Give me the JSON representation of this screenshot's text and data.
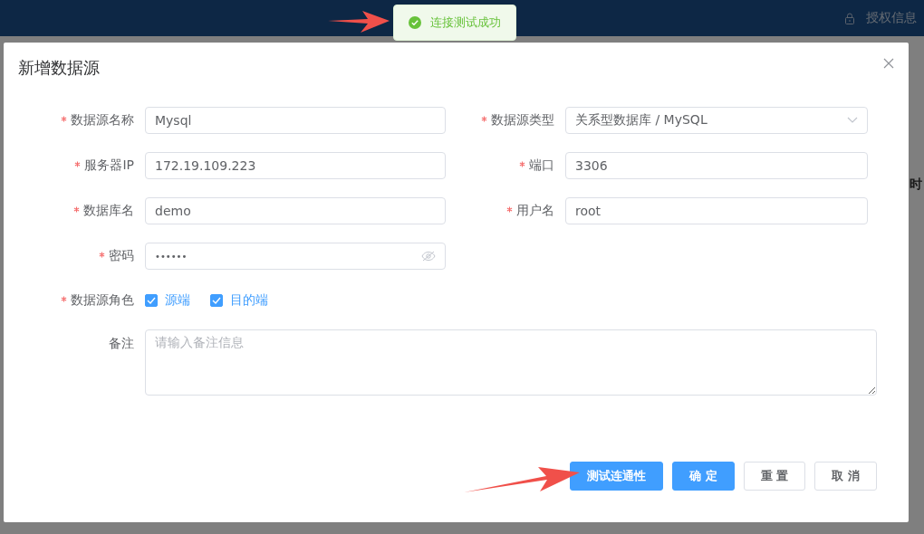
{
  "header": {
    "auth_label": "授权信息"
  },
  "background": {
    "column_fragment": "时"
  },
  "toast": {
    "kind": "success",
    "message": "连接测试成功"
  },
  "dialog": {
    "title": "新增数据源",
    "fields": [
      {
        "label": "数据源名称",
        "required": true,
        "kind": "text",
        "value": "Mysql"
      },
      {
        "label": "数据源类型",
        "required": true,
        "kind": "select",
        "value": "关系型数据库 / MySQL"
      },
      {
        "label": "服务器IP",
        "required": true,
        "kind": "text",
        "value": "172.19.109.223"
      },
      {
        "label": "端口",
        "required": true,
        "kind": "text",
        "value": "3306"
      },
      {
        "label": "数据库名",
        "required": true,
        "kind": "text",
        "value": "demo"
      },
      {
        "label": "用户名",
        "required": true,
        "kind": "text",
        "value": "root"
      },
      {
        "label": "密码",
        "required": true,
        "kind": "password",
        "value": "••••••"
      }
    ],
    "roles": {
      "label": "数据源角色",
      "required": true,
      "options": [
        {
          "label": "源端",
          "checked": true
        },
        {
          "label": "目的端",
          "checked": true
        }
      ]
    },
    "remark": {
      "label": "备注",
      "required": false,
      "placeholder": "请输入备注信息"
    },
    "buttons": [
      {
        "label": "测试连通性",
        "kind": "primary"
      },
      {
        "label": "确 定",
        "kind": "primary"
      },
      {
        "label": "重 置",
        "kind": "default"
      },
      {
        "label": "取 消",
        "kind": "default"
      }
    ]
  }
}
